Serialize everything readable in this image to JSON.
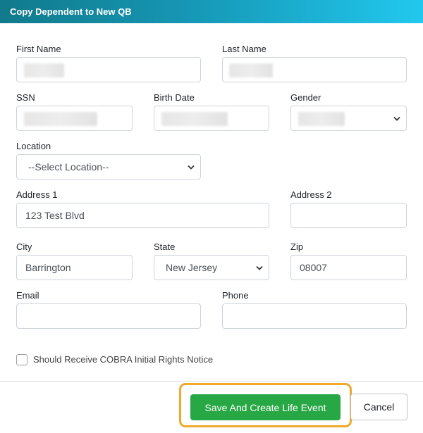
{
  "header": {
    "title": "Copy Dependent to New QB"
  },
  "form": {
    "first_name": {
      "label": "First Name",
      "value": ""
    },
    "last_name": {
      "label": "Last Name",
      "value": ""
    },
    "ssn": {
      "label": "SSN",
      "value": ""
    },
    "birth_date": {
      "label": "Birth Date",
      "value": ""
    },
    "gender": {
      "label": "Gender",
      "value": ""
    },
    "location": {
      "label": "Location",
      "value": "--Select Location--"
    },
    "address1": {
      "label": "Address 1",
      "value": "123 Test Blvd"
    },
    "address2": {
      "label": "Address 2",
      "value": ""
    },
    "city": {
      "label": "City",
      "value": "Barrington"
    },
    "state": {
      "label": "State",
      "value": "New Jersey"
    },
    "zip": {
      "label": "Zip",
      "value": "08007"
    },
    "email": {
      "label": "Email",
      "value": ""
    },
    "phone": {
      "label": "Phone",
      "value": ""
    },
    "cobra_checkbox": {
      "label": "Should Receive COBRA Initial Rights Notice",
      "checked": false
    }
  },
  "footer": {
    "save_label": "Save And Create Life Event",
    "cancel_label": "Cancel"
  },
  "colors": {
    "header_start": "#117a8b",
    "header_end": "#22c8ee",
    "save_button": "#28a745",
    "highlight": "#f0a92a"
  }
}
